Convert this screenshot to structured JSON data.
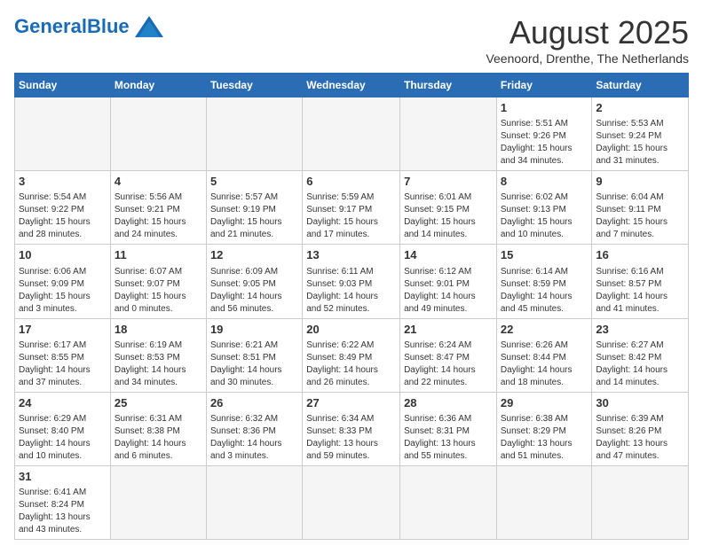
{
  "header": {
    "logo_general": "General",
    "logo_blue": "Blue",
    "month": "August 2025",
    "location": "Veenoord, Drenthe, The Netherlands"
  },
  "weekdays": [
    "Sunday",
    "Monday",
    "Tuesday",
    "Wednesday",
    "Thursday",
    "Friday",
    "Saturday"
  ],
  "weeks": [
    [
      {
        "day": "",
        "info": ""
      },
      {
        "day": "",
        "info": ""
      },
      {
        "day": "",
        "info": ""
      },
      {
        "day": "",
        "info": ""
      },
      {
        "day": "",
        "info": ""
      },
      {
        "day": "1",
        "info": "Sunrise: 5:51 AM\nSunset: 9:26 PM\nDaylight: 15 hours\nand 34 minutes."
      },
      {
        "day": "2",
        "info": "Sunrise: 5:53 AM\nSunset: 9:24 PM\nDaylight: 15 hours\nand 31 minutes."
      }
    ],
    [
      {
        "day": "3",
        "info": "Sunrise: 5:54 AM\nSunset: 9:22 PM\nDaylight: 15 hours\nand 28 minutes."
      },
      {
        "day": "4",
        "info": "Sunrise: 5:56 AM\nSunset: 9:21 PM\nDaylight: 15 hours\nand 24 minutes."
      },
      {
        "day": "5",
        "info": "Sunrise: 5:57 AM\nSunset: 9:19 PM\nDaylight: 15 hours\nand 21 minutes."
      },
      {
        "day": "6",
        "info": "Sunrise: 5:59 AM\nSunset: 9:17 PM\nDaylight: 15 hours\nand 17 minutes."
      },
      {
        "day": "7",
        "info": "Sunrise: 6:01 AM\nSunset: 9:15 PM\nDaylight: 15 hours\nand 14 minutes."
      },
      {
        "day": "8",
        "info": "Sunrise: 6:02 AM\nSunset: 9:13 PM\nDaylight: 15 hours\nand 10 minutes."
      },
      {
        "day": "9",
        "info": "Sunrise: 6:04 AM\nSunset: 9:11 PM\nDaylight: 15 hours\nand 7 minutes."
      }
    ],
    [
      {
        "day": "10",
        "info": "Sunrise: 6:06 AM\nSunset: 9:09 PM\nDaylight: 15 hours\nand 3 minutes."
      },
      {
        "day": "11",
        "info": "Sunrise: 6:07 AM\nSunset: 9:07 PM\nDaylight: 15 hours\nand 0 minutes."
      },
      {
        "day": "12",
        "info": "Sunrise: 6:09 AM\nSunset: 9:05 PM\nDaylight: 14 hours\nand 56 minutes."
      },
      {
        "day": "13",
        "info": "Sunrise: 6:11 AM\nSunset: 9:03 PM\nDaylight: 14 hours\nand 52 minutes."
      },
      {
        "day": "14",
        "info": "Sunrise: 6:12 AM\nSunset: 9:01 PM\nDaylight: 14 hours\nand 49 minutes."
      },
      {
        "day": "15",
        "info": "Sunrise: 6:14 AM\nSunset: 8:59 PM\nDaylight: 14 hours\nand 45 minutes."
      },
      {
        "day": "16",
        "info": "Sunrise: 6:16 AM\nSunset: 8:57 PM\nDaylight: 14 hours\nand 41 minutes."
      }
    ],
    [
      {
        "day": "17",
        "info": "Sunrise: 6:17 AM\nSunset: 8:55 PM\nDaylight: 14 hours\nand 37 minutes."
      },
      {
        "day": "18",
        "info": "Sunrise: 6:19 AM\nSunset: 8:53 PM\nDaylight: 14 hours\nand 34 minutes."
      },
      {
        "day": "19",
        "info": "Sunrise: 6:21 AM\nSunset: 8:51 PM\nDaylight: 14 hours\nand 30 minutes."
      },
      {
        "day": "20",
        "info": "Sunrise: 6:22 AM\nSunset: 8:49 PM\nDaylight: 14 hours\nand 26 minutes."
      },
      {
        "day": "21",
        "info": "Sunrise: 6:24 AM\nSunset: 8:47 PM\nDaylight: 14 hours\nand 22 minutes."
      },
      {
        "day": "22",
        "info": "Sunrise: 6:26 AM\nSunset: 8:44 PM\nDaylight: 14 hours\nand 18 minutes."
      },
      {
        "day": "23",
        "info": "Sunrise: 6:27 AM\nSunset: 8:42 PM\nDaylight: 14 hours\nand 14 minutes."
      }
    ],
    [
      {
        "day": "24",
        "info": "Sunrise: 6:29 AM\nSunset: 8:40 PM\nDaylight: 14 hours\nand 10 minutes."
      },
      {
        "day": "25",
        "info": "Sunrise: 6:31 AM\nSunset: 8:38 PM\nDaylight: 14 hours\nand 6 minutes."
      },
      {
        "day": "26",
        "info": "Sunrise: 6:32 AM\nSunset: 8:36 PM\nDaylight: 14 hours\nand 3 minutes."
      },
      {
        "day": "27",
        "info": "Sunrise: 6:34 AM\nSunset: 8:33 PM\nDaylight: 13 hours\nand 59 minutes."
      },
      {
        "day": "28",
        "info": "Sunrise: 6:36 AM\nSunset: 8:31 PM\nDaylight: 13 hours\nand 55 minutes."
      },
      {
        "day": "29",
        "info": "Sunrise: 6:38 AM\nSunset: 8:29 PM\nDaylight: 13 hours\nand 51 minutes."
      },
      {
        "day": "30",
        "info": "Sunrise: 6:39 AM\nSunset: 8:26 PM\nDaylight: 13 hours\nand 47 minutes."
      }
    ],
    [
      {
        "day": "31",
        "info": "Sunrise: 6:41 AM\nSunset: 8:24 PM\nDaylight: 13 hours\nand 43 minutes."
      },
      {
        "day": "",
        "info": ""
      },
      {
        "day": "",
        "info": ""
      },
      {
        "day": "",
        "info": ""
      },
      {
        "day": "",
        "info": ""
      },
      {
        "day": "",
        "info": ""
      },
      {
        "day": "",
        "info": ""
      }
    ]
  ]
}
